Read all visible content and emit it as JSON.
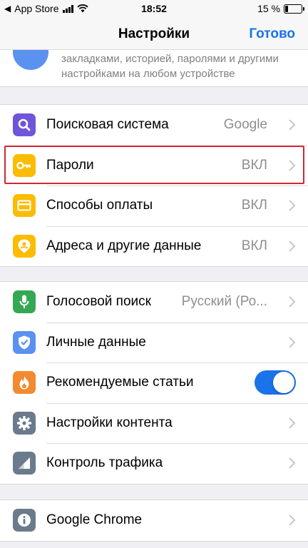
{
  "status_bar": {
    "back_app": "App Store",
    "time": "18:52",
    "battery_percent": "15 %"
  },
  "nav": {
    "title": "Настройки",
    "done_label": "Готово"
  },
  "account": {
    "sync_line1": "закладками, историей, паролями и другими",
    "sync_line2": "настройками на любом устройстве"
  },
  "group1": [
    {
      "label": "Поисковая система",
      "value": "Google",
      "icon": "search-icon",
      "color": "#6f55d9"
    },
    {
      "label": "Пароли",
      "value": "ВКЛ",
      "icon": "key-icon",
      "color": "#fbbc04"
    },
    {
      "label": "Способы оплаты",
      "value": "ВКЛ",
      "icon": "credit-card-icon",
      "color": "#fbbc04"
    },
    {
      "label": "Адреса и другие данные",
      "value": "ВКЛ",
      "icon": "location-person-icon",
      "color": "#fbbc04"
    }
  ],
  "group2": [
    {
      "label": "Голосовой поиск",
      "value": "Русский (Ро...",
      "icon": "microphone-icon",
      "color": "#34a853"
    },
    {
      "label": "Личные данные",
      "value": "",
      "icon": "shield-check-icon",
      "color": "#5b92f0"
    },
    {
      "label": "Рекомендуемые статьи",
      "value": "",
      "icon": "flame-icon",
      "color": "#f28b30",
      "toggle_on": true
    },
    {
      "label": "Настройки контента",
      "value": "",
      "icon": "gear-icon",
      "color": "#6b7b8c"
    },
    {
      "label": "Контроль трафика",
      "value": "",
      "icon": "signal-triangle-icon",
      "color": "#6b7b8c"
    }
  ],
  "group3": [
    {
      "label": "Google Chrome",
      "value": "",
      "icon": "info-icon",
      "color": "#6b7b8c"
    }
  ],
  "colors": {
    "accent": "#1a73e8",
    "highlight": "#d0282f"
  }
}
